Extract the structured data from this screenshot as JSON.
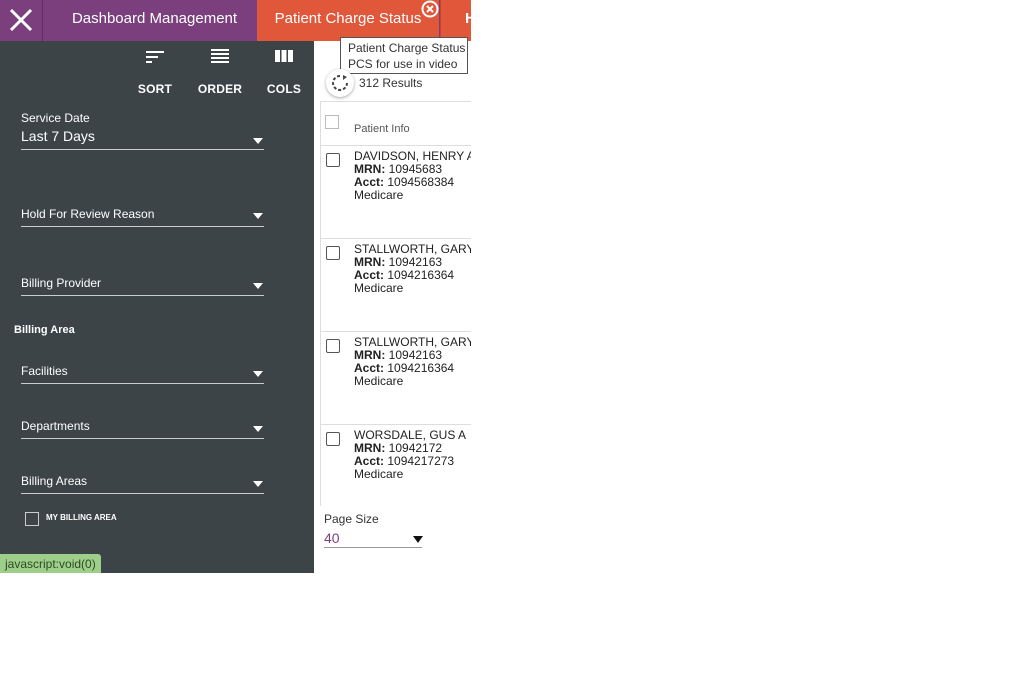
{
  "tabs": {
    "dashboard": "Dashboard Management",
    "pcs": "Patient Charge Status",
    "next": "H"
  },
  "tooltip": {
    "line1": "Patient Charge Status",
    "line2": "PCS for use in video"
  },
  "toolbar": {
    "sort": "SORT",
    "order": "ORDER",
    "cols": "COLS"
  },
  "filters": {
    "service_date_label": "Service Date",
    "service_date_value": "Last 7 Days",
    "hold_reason": "Hold For Review Reason",
    "billing_provider": "Billing Provider",
    "billing_area_section": "Billing Area",
    "facilities": "Facilities",
    "departments": "Departments",
    "billing_areas": "Billing Areas",
    "my_billing_area": "MY BILLING AREA"
  },
  "status_bar": "javascript:void(0)",
  "results": {
    "count_text": "312 Results",
    "column_header": "Patient Info",
    "mrn_label": "MRN:",
    "acct_label": "Acct:",
    "rows": [
      {
        "name": "DAVIDSON, HENRY A",
        "mrn": "10945683",
        "acct": "1094568384",
        "payer": "Medicare"
      },
      {
        "name": "STALLWORTH, GARY",
        "mrn": "10942163",
        "acct": "1094216364",
        "payer": "Medicare"
      },
      {
        "name": "STALLWORTH, GARY",
        "mrn": "10942163",
        "acct": "1094216364",
        "payer": "Medicare"
      },
      {
        "name": "WORSDALE, GUS A",
        "mrn": "10942172",
        "acct": "1094217273",
        "payer": "Medicare"
      }
    ]
  },
  "page_size": {
    "label": "Page Size",
    "value": "40"
  },
  "colors": {
    "topbar": "#7b3f7e",
    "active_tab": "#e0573a",
    "sidebar": "#3c4448",
    "status_pill": "#9ecf8a"
  }
}
